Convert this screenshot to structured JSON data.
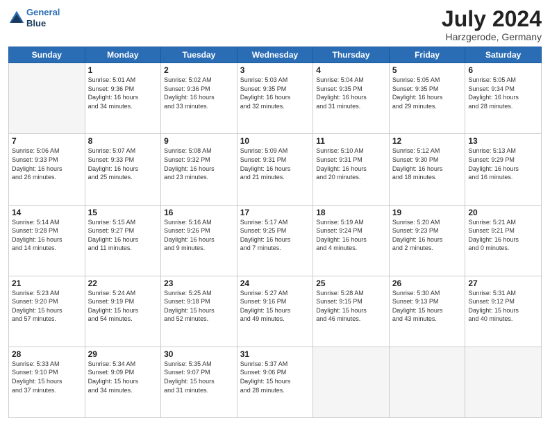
{
  "logo": {
    "line1": "General",
    "line2": "Blue"
  },
  "title": "July 2024",
  "subtitle": "Harzgerode, Germany",
  "days_of_week": [
    "Sunday",
    "Monday",
    "Tuesday",
    "Wednesday",
    "Thursday",
    "Friday",
    "Saturday"
  ],
  "weeks": [
    [
      {
        "day": "",
        "info": ""
      },
      {
        "day": "1",
        "info": "Sunrise: 5:01 AM\nSunset: 9:36 PM\nDaylight: 16 hours\nand 34 minutes."
      },
      {
        "day": "2",
        "info": "Sunrise: 5:02 AM\nSunset: 9:36 PM\nDaylight: 16 hours\nand 33 minutes."
      },
      {
        "day": "3",
        "info": "Sunrise: 5:03 AM\nSunset: 9:35 PM\nDaylight: 16 hours\nand 32 minutes."
      },
      {
        "day": "4",
        "info": "Sunrise: 5:04 AM\nSunset: 9:35 PM\nDaylight: 16 hours\nand 31 minutes."
      },
      {
        "day": "5",
        "info": "Sunrise: 5:05 AM\nSunset: 9:35 PM\nDaylight: 16 hours\nand 29 minutes."
      },
      {
        "day": "6",
        "info": "Sunrise: 5:05 AM\nSunset: 9:34 PM\nDaylight: 16 hours\nand 28 minutes."
      }
    ],
    [
      {
        "day": "7",
        "info": "Sunrise: 5:06 AM\nSunset: 9:33 PM\nDaylight: 16 hours\nand 26 minutes."
      },
      {
        "day": "8",
        "info": "Sunrise: 5:07 AM\nSunset: 9:33 PM\nDaylight: 16 hours\nand 25 minutes."
      },
      {
        "day": "9",
        "info": "Sunrise: 5:08 AM\nSunset: 9:32 PM\nDaylight: 16 hours\nand 23 minutes."
      },
      {
        "day": "10",
        "info": "Sunrise: 5:09 AM\nSunset: 9:31 PM\nDaylight: 16 hours\nand 21 minutes."
      },
      {
        "day": "11",
        "info": "Sunrise: 5:10 AM\nSunset: 9:31 PM\nDaylight: 16 hours\nand 20 minutes."
      },
      {
        "day": "12",
        "info": "Sunrise: 5:12 AM\nSunset: 9:30 PM\nDaylight: 16 hours\nand 18 minutes."
      },
      {
        "day": "13",
        "info": "Sunrise: 5:13 AM\nSunset: 9:29 PM\nDaylight: 16 hours\nand 16 minutes."
      }
    ],
    [
      {
        "day": "14",
        "info": "Sunrise: 5:14 AM\nSunset: 9:28 PM\nDaylight: 16 hours\nand 14 minutes."
      },
      {
        "day": "15",
        "info": "Sunrise: 5:15 AM\nSunset: 9:27 PM\nDaylight: 16 hours\nand 11 minutes."
      },
      {
        "day": "16",
        "info": "Sunrise: 5:16 AM\nSunset: 9:26 PM\nDaylight: 16 hours\nand 9 minutes."
      },
      {
        "day": "17",
        "info": "Sunrise: 5:17 AM\nSunset: 9:25 PM\nDaylight: 16 hours\nand 7 minutes."
      },
      {
        "day": "18",
        "info": "Sunrise: 5:19 AM\nSunset: 9:24 PM\nDaylight: 16 hours\nand 4 minutes."
      },
      {
        "day": "19",
        "info": "Sunrise: 5:20 AM\nSunset: 9:23 PM\nDaylight: 16 hours\nand 2 minutes."
      },
      {
        "day": "20",
        "info": "Sunrise: 5:21 AM\nSunset: 9:21 PM\nDaylight: 16 hours\nand 0 minutes."
      }
    ],
    [
      {
        "day": "21",
        "info": "Sunrise: 5:23 AM\nSunset: 9:20 PM\nDaylight: 15 hours\nand 57 minutes."
      },
      {
        "day": "22",
        "info": "Sunrise: 5:24 AM\nSunset: 9:19 PM\nDaylight: 15 hours\nand 54 minutes."
      },
      {
        "day": "23",
        "info": "Sunrise: 5:25 AM\nSunset: 9:18 PM\nDaylight: 15 hours\nand 52 minutes."
      },
      {
        "day": "24",
        "info": "Sunrise: 5:27 AM\nSunset: 9:16 PM\nDaylight: 15 hours\nand 49 minutes."
      },
      {
        "day": "25",
        "info": "Sunrise: 5:28 AM\nSunset: 9:15 PM\nDaylight: 15 hours\nand 46 minutes."
      },
      {
        "day": "26",
        "info": "Sunrise: 5:30 AM\nSunset: 9:13 PM\nDaylight: 15 hours\nand 43 minutes."
      },
      {
        "day": "27",
        "info": "Sunrise: 5:31 AM\nSunset: 9:12 PM\nDaylight: 15 hours\nand 40 minutes."
      }
    ],
    [
      {
        "day": "28",
        "info": "Sunrise: 5:33 AM\nSunset: 9:10 PM\nDaylight: 15 hours\nand 37 minutes."
      },
      {
        "day": "29",
        "info": "Sunrise: 5:34 AM\nSunset: 9:09 PM\nDaylight: 15 hours\nand 34 minutes."
      },
      {
        "day": "30",
        "info": "Sunrise: 5:35 AM\nSunset: 9:07 PM\nDaylight: 15 hours\nand 31 minutes."
      },
      {
        "day": "31",
        "info": "Sunrise: 5:37 AM\nSunset: 9:06 PM\nDaylight: 15 hours\nand 28 minutes."
      },
      {
        "day": "",
        "info": ""
      },
      {
        "day": "",
        "info": ""
      },
      {
        "day": "",
        "info": ""
      }
    ]
  ]
}
